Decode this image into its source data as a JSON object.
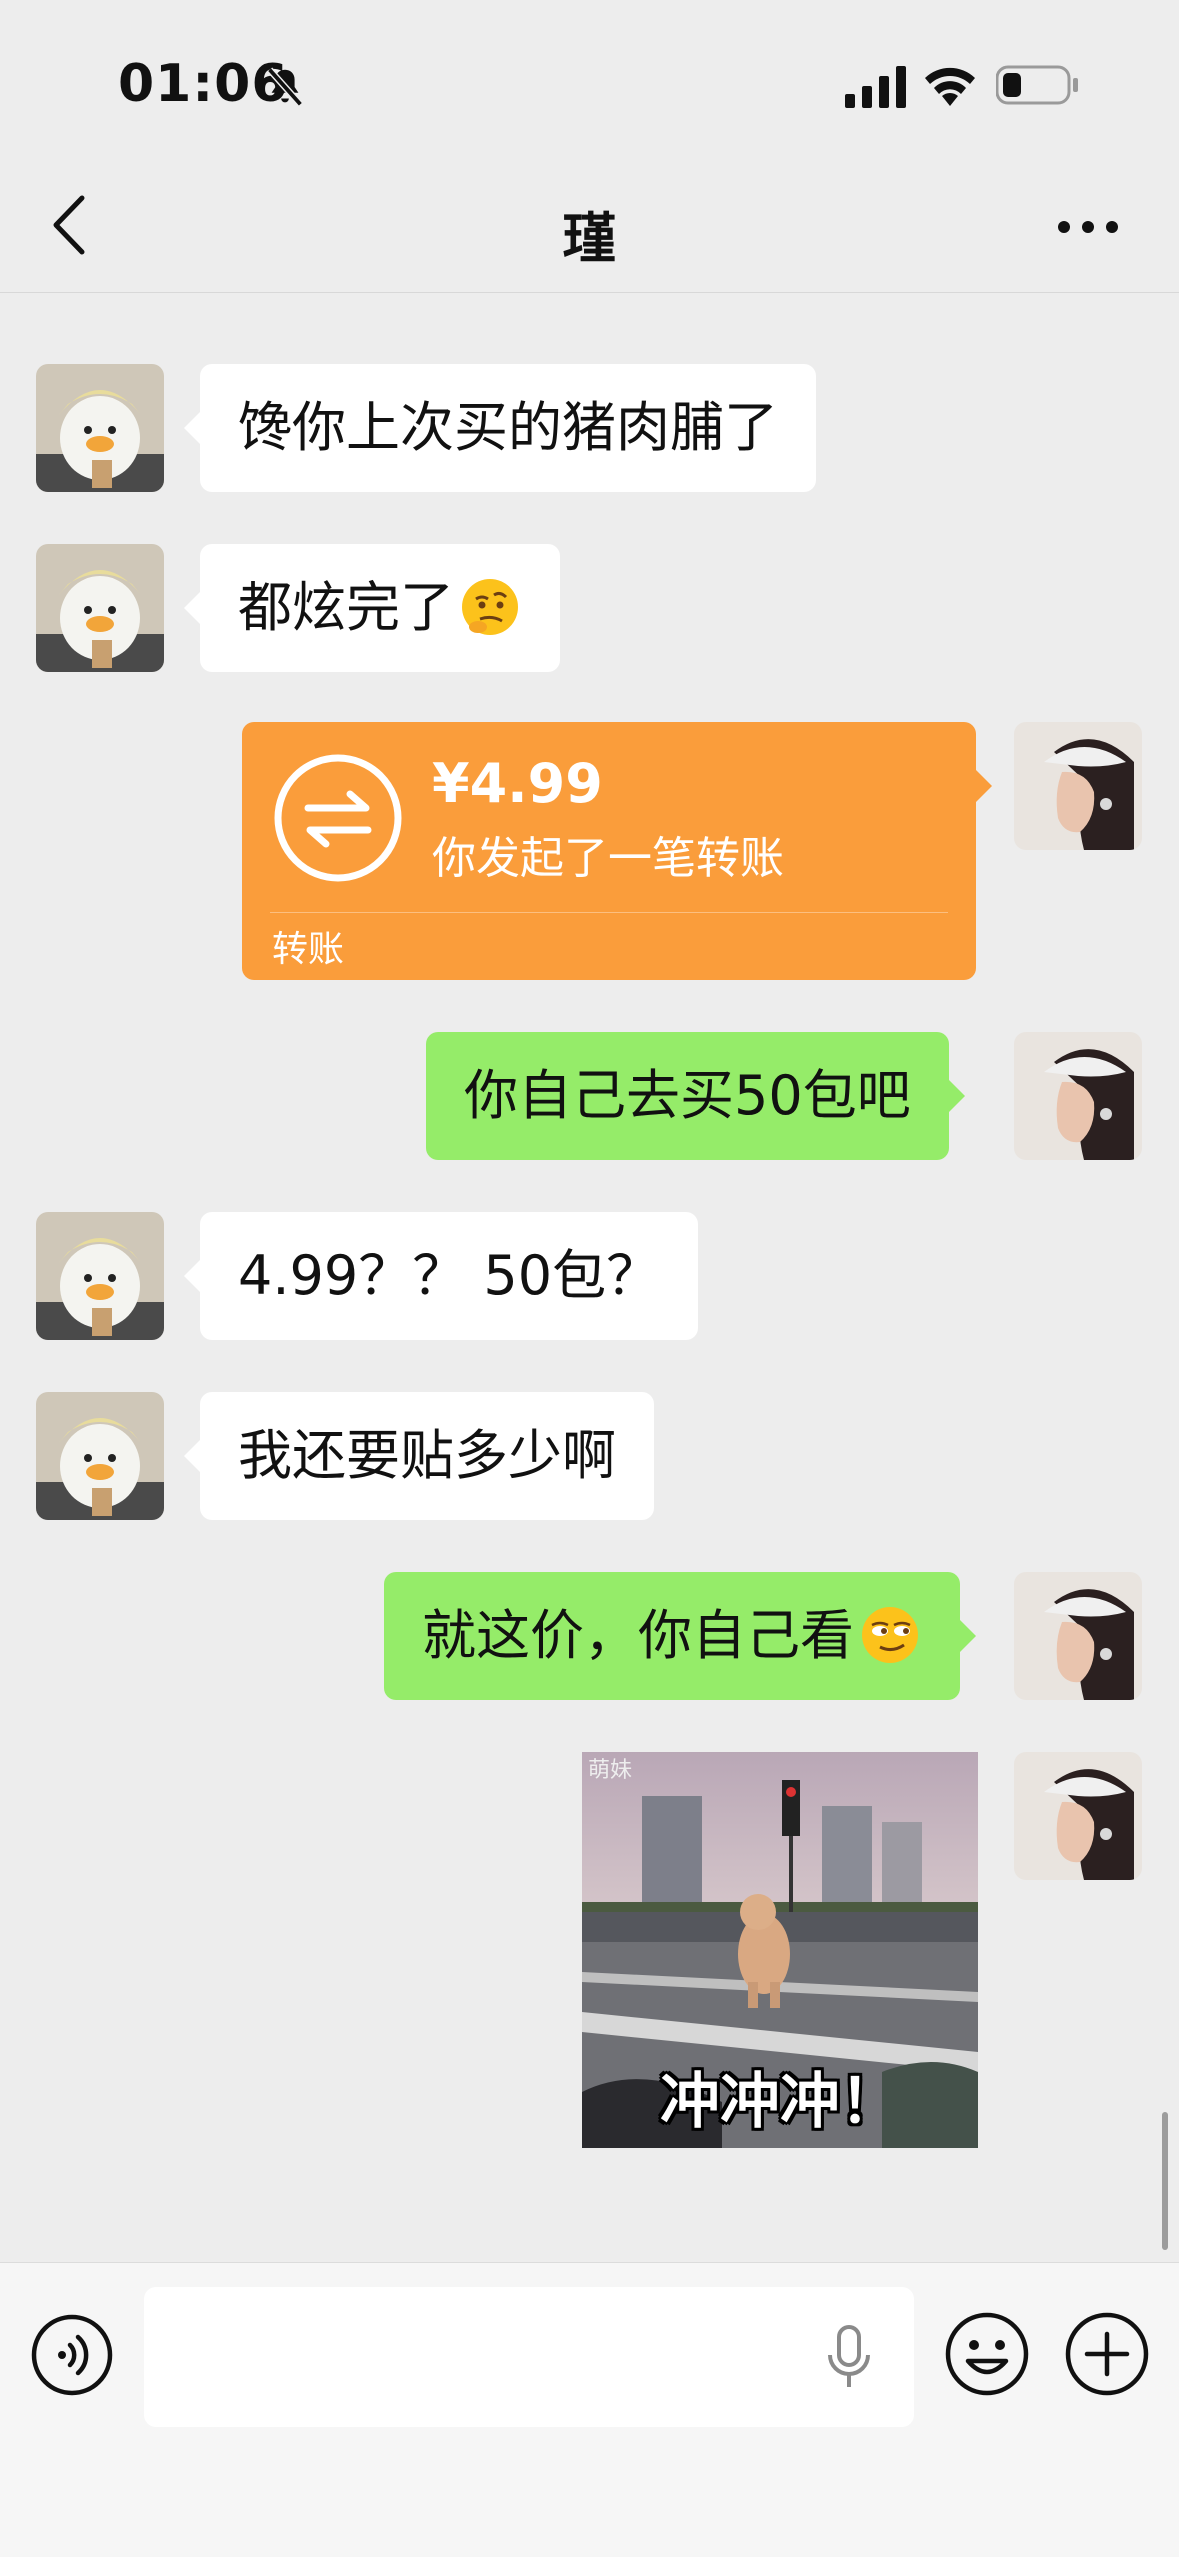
{
  "status_bar": {
    "time": "01:06"
  },
  "nav": {
    "title": "瑾"
  },
  "messages": [
    {
      "side": "in",
      "text": "馋你上次买的猪肉脯了"
    },
    {
      "side": "in",
      "text": "都炫完了",
      "emoji": "thinking-face"
    },
    {
      "side": "out",
      "type": "transfer",
      "amount": "¥4.99",
      "desc": "你发起了一笔转账",
      "label": "转账"
    },
    {
      "side": "out",
      "text": "你自己去买50包吧"
    },
    {
      "side": "in",
      "text": "4.99？？ 50包？"
    },
    {
      "side": "in",
      "text": "我还要贴多少啊"
    },
    {
      "side": "out",
      "text": "就这价，你自己看",
      "emoji": "smirk-face"
    },
    {
      "side": "out",
      "type": "gif",
      "caption": "冲冲冲！",
      "watermark": "萌妹"
    }
  ],
  "input": {
    "value": "",
    "placeholder": ""
  },
  "icons": {
    "back": "chevron-left-icon",
    "more": "ellipsis-icon",
    "voice": "voice-icon",
    "mic": "microphone-icon",
    "emoji": "emoji-icon",
    "plus": "plus-icon",
    "transfer": "transfer-arrows-icon"
  },
  "colors": {
    "background": "#ededed",
    "incoming_bubble": "#ffffff",
    "outgoing_bubble": "#95ec69",
    "transfer_card": "#fa9d3b"
  }
}
